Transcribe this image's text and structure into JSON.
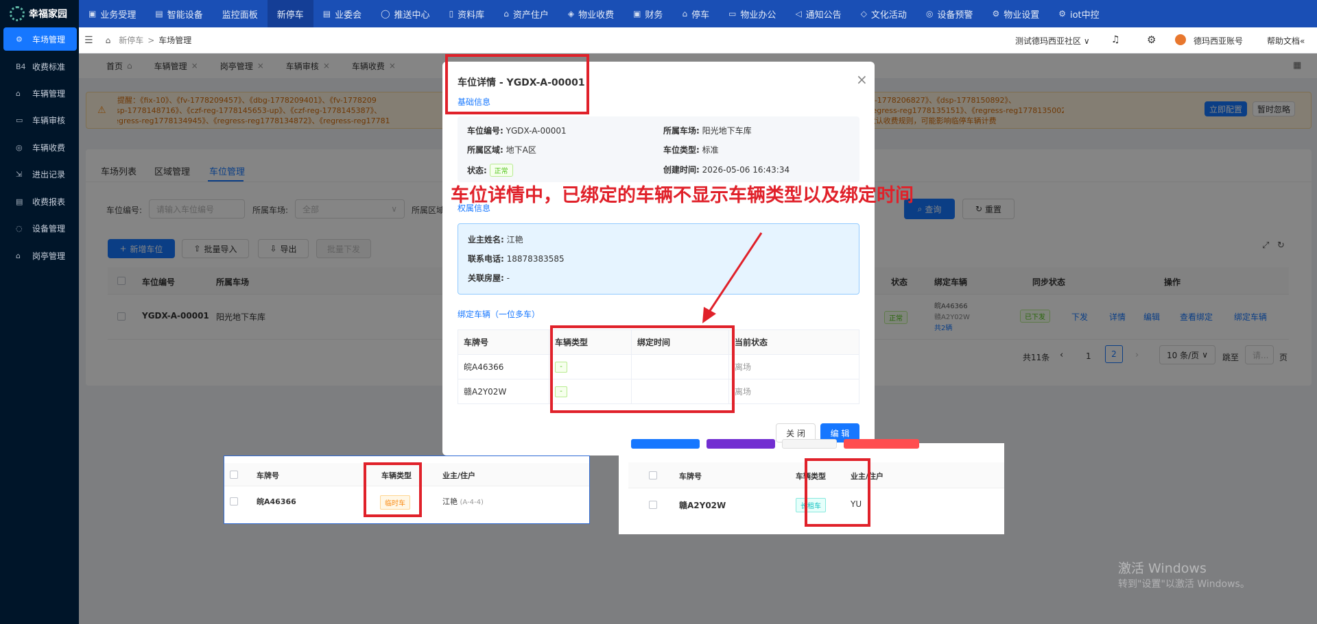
{
  "app": {
    "name": "幸福家园"
  },
  "sidebar": {
    "items": [
      {
        "label": "车场管理",
        "icon": "gear-icon"
      },
      {
        "label": "收费标准",
        "icon": "rmb-icon"
      },
      {
        "label": "车辆管理",
        "icon": "car-icon"
      },
      {
        "label": "车辆审核",
        "icon": "audit-icon"
      },
      {
        "label": "车辆收费",
        "icon": "coin-icon"
      },
      {
        "label": "进出记录",
        "icon": "record-icon"
      },
      {
        "label": "收费报表",
        "icon": "report-icon"
      },
      {
        "label": "设备管理",
        "icon": "device-icon"
      },
      {
        "label": "岗亭管理",
        "icon": "booth-icon"
      }
    ]
  },
  "topnav": {
    "items": [
      "业务受理",
      "智能设备",
      "监控面板",
      "新停车",
      "业委会",
      "推送中心",
      "资料库",
      "资产住户",
      "物业收费",
      "财务",
      "停车",
      "物业办公",
      "通知公告",
      "文化活动",
      "设备预警",
      "物业设置",
      "iot中控"
    ]
  },
  "breadcrumb": {
    "parent": "新停车",
    "sep": ">",
    "current": "车场管理"
  },
  "header": {
    "community": "测试德玛西亚社区",
    "account": "德玛西亚账号",
    "help": "帮助文档"
  },
  "tabs": [
    "首页",
    "车辆管理",
    "岗亭管理",
    "车辆审核",
    "车辆收费"
  ],
  "notice": {
    "line1_left": "提醒：《fix-10》、《fv-1778209457》、《dbg-1778209401》、《fv-1778209",
    "line1_right": "123》、《vb-1778206977》、《vb-1778206827》、《dsp-1778150892》、",
    "line2_left": "《dsp-1778148716》、《czf-reg-1778145653-up》、《czf-reg-1778145387》、",
    "line2_right": "8135247》、《regress-reg1778135151》、《regress-reg1778135002》、",
    "line3_left": "《regress-reg1778134945》、《regress-reg1778134872》、《regress-reg17781",
    "line3_right": "《同步测试车场》尚未配置默认收费规则，可能影响临停车辆计费",
    "config_btn": "立即配置",
    "ignore_btn": "暂时忽略"
  },
  "subtabs": [
    "车场列表",
    "区域管理",
    "车位管理"
  ],
  "filter": {
    "space_no_label": "车位编号:",
    "space_no_placeholder": "请输入车位编号",
    "lot_label": "所属车场:",
    "lot_value": "全部",
    "zone_label": "所属区域",
    "query": "查询",
    "reset": "重置"
  },
  "actions": {
    "add": "新增车位",
    "import": "批量导入",
    "export": "导出",
    "batch": "批量下发"
  },
  "table": {
    "headers": {
      "no": "车位编号",
      "lot": "所属车场",
      "status": "状态",
      "bound": "绑定车辆",
      "sync": "同步状态",
      "ops": "操作"
    },
    "row": {
      "no": "YGDX-A-00001",
      "lot": "阳光地下车库",
      "status": "正常",
      "plate1": "皖A46366",
      "plate2": "赣A2Y02W",
      "more": "共2辆",
      "sync": "已下发",
      "push": "下发",
      "detail": "详情",
      "edit": "编辑",
      "view_bind": "查看绑定",
      "bind": "绑定车辆"
    }
  },
  "pagination": {
    "total": "共11条",
    "p1": "1",
    "p2": "2",
    "size": "10 条/页",
    "goto": "跳至",
    "goto_placeholder": "请...",
    "page": "页"
  },
  "modal": {
    "title": "车位详情 - YGDX-A-00001",
    "section_basic": "基础信息",
    "space_no_k": "车位编号:",
    "space_no_v": "YGDX-A-00001",
    "lot_k": "所属车场:",
    "lot_v": "阳光地下车库",
    "zone_k": "所属区域:",
    "zone_v": "地下A区",
    "type_k": "车位类型:",
    "type_v": "标准",
    "status_k": "状态:",
    "status_v": "正常",
    "created_k": "创建时间:",
    "created_v": "2026-05-06 16:43:34",
    "section_owner": "权属信息",
    "owner_k": "业主姓名:",
    "owner_v": "江艳",
    "phone_k": "联系电话:",
    "phone_v": "18878383585",
    "house_k": "关联房屋:",
    "house_v": "-",
    "section_bound": "绑定车辆（一位多车）",
    "headers": {
      "plate": "车牌号",
      "type": "车辆类型",
      "time": "绑定时间",
      "state": "当前状态"
    },
    "rows": [
      {
        "plate": "皖A46366",
        "type": "-",
        "time": "",
        "state": "离场"
      },
      {
        "plate": "赣A2Y02W",
        "type": "-",
        "time": "",
        "state": "离场"
      }
    ],
    "close": "关 闭",
    "edit": "编 辑"
  },
  "annotation": {
    "text": "车位详情中，已绑定的车辆不显示车辆类型以及绑定时间",
    "color": "#e0212a"
  },
  "snippet_left": {
    "headers": {
      "plate": "车牌号",
      "type": "车辆类型",
      "owner": "业主/住户"
    },
    "plate": "皖A46366",
    "type": "临时车",
    "owner": "江艳",
    "house": "(A-4-4)"
  },
  "snippet_right": {
    "headers": {
      "plate": "车牌号",
      "type": "车辆类型",
      "owner": "业主/住户"
    },
    "plate": "赣A2Y02W",
    "type": "长租车",
    "owner": "YU"
  },
  "windows": {
    "line1": "激活 Windows",
    "line2": "转到\"设置\"以激活 Windows。"
  }
}
